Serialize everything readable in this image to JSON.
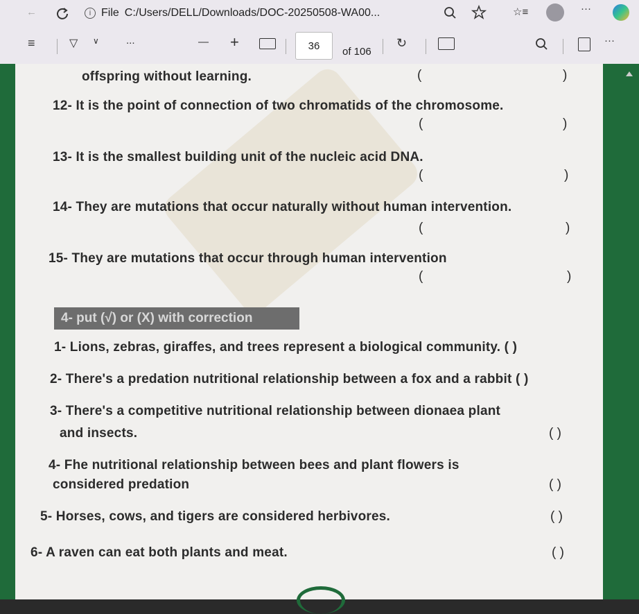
{
  "browser": {
    "file_label": "File",
    "url": "C:/Users/DELL/Downloads/DOC-20250508-WA00..."
  },
  "pdf_toolbar": {
    "current_page": "36",
    "page_total": "of 106",
    "zoom_out": "—",
    "zoom_in": "+",
    "more": "..."
  },
  "document": {
    "lines": [
      "offspring without learning.",
      "12- It is the point of connection of two chromatids of the chromosome.",
      "13- It is the smallest building unit of the nucleic acid DNA.",
      "14- They are mutations that occur naturally without human intervention.",
      "15- They are mutations that occur through human intervention"
    ],
    "section_title": "4- put (√) or (X) with correction",
    "statements": [
      "1- Lions, zebras, giraffes, and trees represent a biological community. (     )",
      "2- There's a predation nutritional relationship between a fox and a rabbit   (     )",
      "3- There's a competitive nutritional relationship between dionaea plant",
      "and insects.",
      "4- Fhe nutritional relationship between bees and plant flowers is",
      "considered predation",
      "5- Horses, cows, and tigers are considered herbivores.",
      "6- A raven can eat both plants and meat."
    ],
    "paren_open": "(",
    "paren_close": ")",
    "paren_pair": "(    )"
  }
}
